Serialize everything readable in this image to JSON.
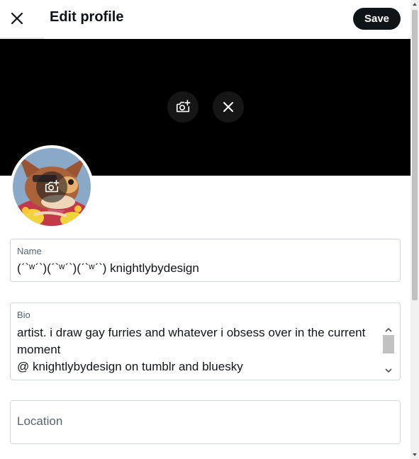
{
  "header": {
    "title": "Edit profile",
    "save_label": "Save",
    "close_icon": "close-icon"
  },
  "banner": {
    "color": "#000000",
    "add_photo_icon": "camera-plus-icon",
    "remove_icon": "close-icon"
  },
  "avatar": {
    "add_photo_icon": "camera-plus-icon"
  },
  "fields": {
    "name": {
      "label": "Name",
      "value": "(ˊ`ʷˊ`)(ˊ`ʷˊ`)(ˊ`ʷˊ`) knightlybydesign"
    },
    "bio": {
      "label": "Bio",
      "lines": [
        "artist. i draw gay furries and whatever i obsess over in the current",
        "moment",
        "@ knightlybydesign on tumblr and bluesky"
      ]
    },
    "location": {
      "placeholder": "Location"
    }
  },
  "colors": {
    "text_primary": "#0f1419",
    "text_secondary": "#536471",
    "border": "#cfd9de",
    "save_bg": "#0f1419"
  }
}
